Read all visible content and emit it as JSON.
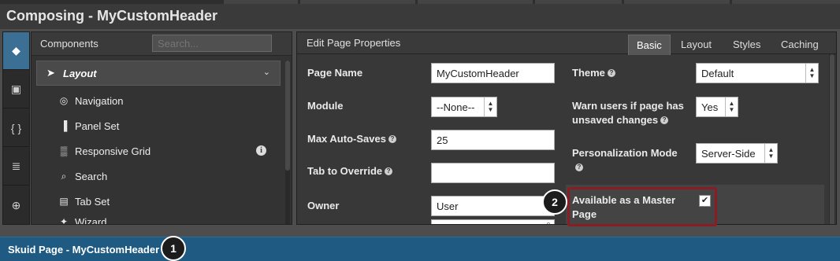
{
  "window": {
    "title": "Composing - MyCustomHeader"
  },
  "rail": {
    "items": [
      {
        "icon": "cube-icon",
        "glyph": "◆"
      },
      {
        "icon": "box-icon",
        "glyph": "▣"
      },
      {
        "icon": "braces-icon",
        "glyph": "{ }"
      },
      {
        "icon": "css3-icon",
        "glyph": "≣"
      },
      {
        "icon": "globe-icon",
        "glyph": "⊕"
      }
    ]
  },
  "components": {
    "header": "Components",
    "search_placeholder": "Search...",
    "category": {
      "label": "Layout",
      "icon": "rocket-icon"
    },
    "items": [
      {
        "label": "Navigation",
        "icon": "compass-icon",
        "glyph": "◎"
      },
      {
        "label": "Panel Set",
        "icon": "panel-set-icon",
        "glyph": "▐"
      },
      {
        "label": "Responsive Grid",
        "icon": "grid-icon",
        "glyph": "▒"
      },
      {
        "label": "Search",
        "icon": "search-icon",
        "glyph": "⌕"
      },
      {
        "label": "Tab Set",
        "icon": "tab-set-icon",
        "glyph": "▤"
      },
      {
        "label": "Wizard",
        "icon": "wand-icon",
        "glyph": "✦"
      }
    ],
    "info_glyph": "i"
  },
  "props": {
    "header": "Edit Page Properties",
    "tabs": [
      "Basic",
      "Layout",
      "Styles",
      "Caching"
    ],
    "active_tab": "Basic",
    "fields": {
      "page_name": {
        "label": "Page Name",
        "value": "MyCustomHeader"
      },
      "module": {
        "label": "Module",
        "value": "--None--"
      },
      "max_auto_saves": {
        "label": "Max Auto-Saves",
        "value": "25"
      },
      "tab_override": {
        "label": "Tab to Override",
        "value": ""
      },
      "owner": {
        "label": "Owner",
        "value": "User"
      },
      "theme": {
        "label": "Theme",
        "value": "Default"
      },
      "warn_unsaved": {
        "label_line1": "Warn users if page has",
        "label_line2": "unsaved changes",
        "value": "Yes"
      },
      "personalization": {
        "label": "Personalization Mode",
        "value": "Server-Side"
      },
      "master_page": {
        "label_line1": "Available as a Master",
        "label_line2": "Page",
        "checked": "✔"
      }
    },
    "help_glyph": "?"
  },
  "callouts": [
    "1",
    "2"
  ],
  "footer": {
    "label": "Skuid Page - MyCustomHeader"
  },
  "colors": {
    "accent": "#3b6f94",
    "footer": "#1e5a82",
    "highlight": "#8a1d24"
  }
}
